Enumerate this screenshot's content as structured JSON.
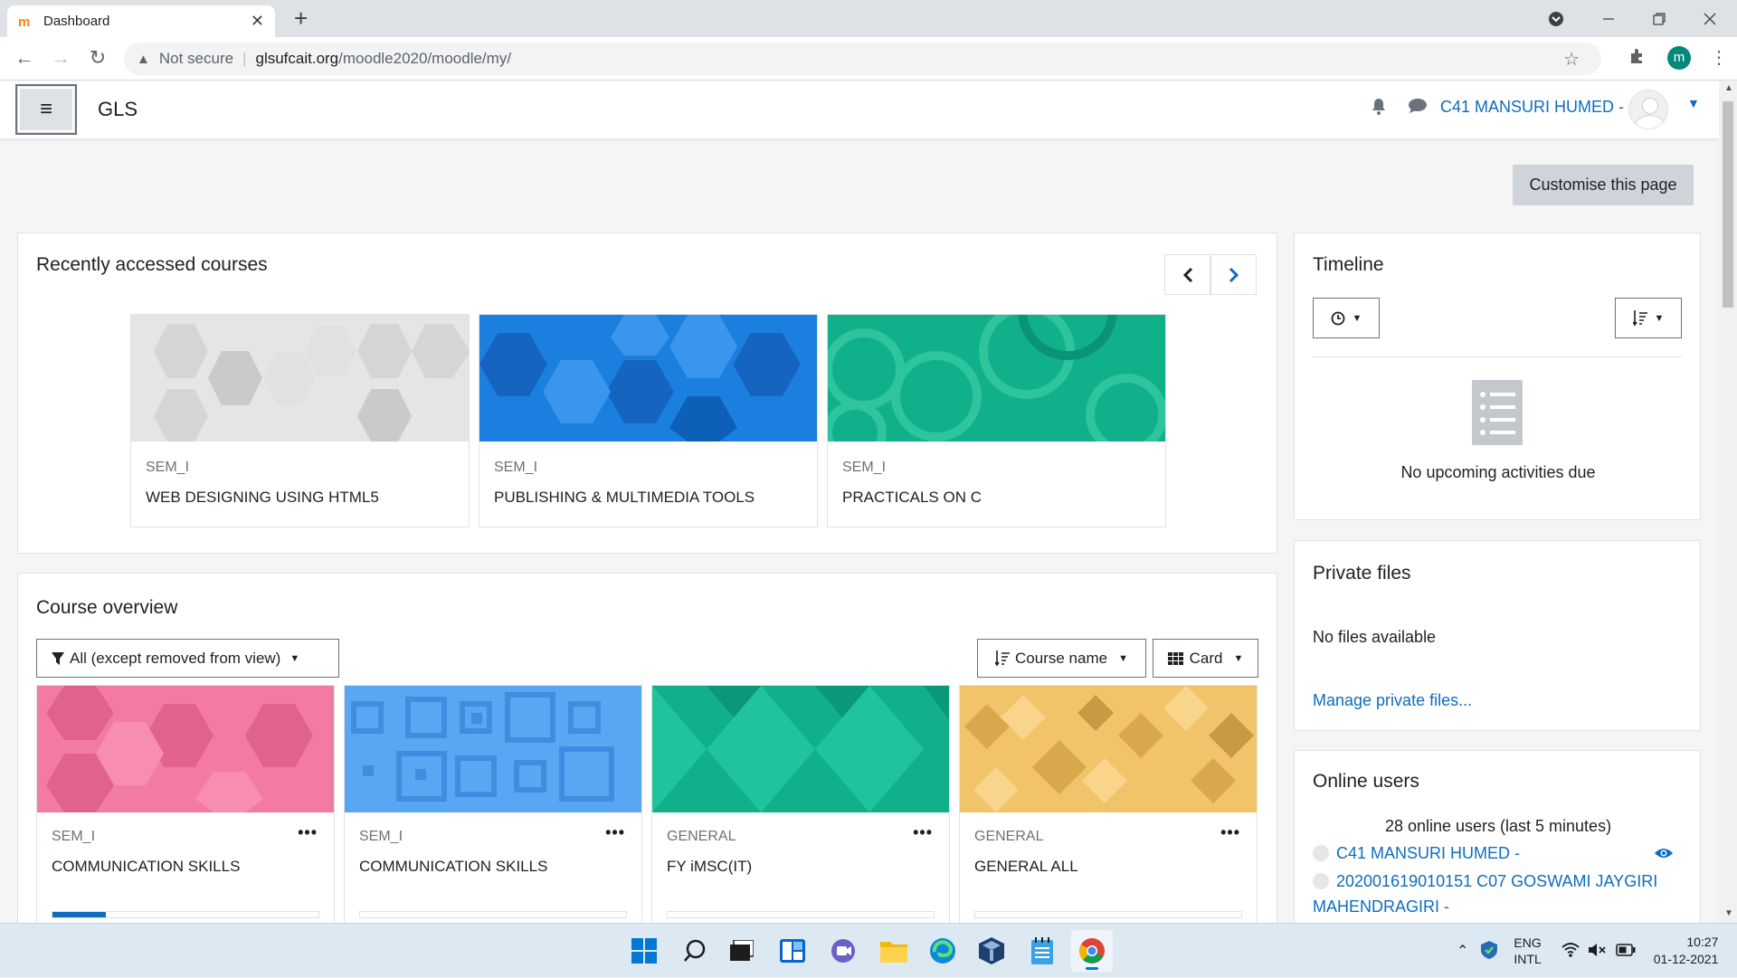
{
  "browser": {
    "tab_title": "Dashboard",
    "tab_close": "✕",
    "new_tab": "+",
    "security_warning": "Not secure",
    "url_host": "glsufcait.org",
    "url_path": "/moodle2020/moodle/my/",
    "profile_initial": "m"
  },
  "navbar": {
    "brand": "GLS",
    "username": "C41 MANSURI HUMED -"
  },
  "page": {
    "customise_label": "Customise this page"
  },
  "recent": {
    "title": "Recently accessed courses",
    "courses": [
      {
        "category": "SEM_I",
        "name": "WEB DESIGNING USING HTML5"
      },
      {
        "category": "SEM_I",
        "name": "PUBLISHING & MULTIMEDIA TOOLS"
      },
      {
        "category": "SEM_I",
        "name": "PRACTICALS ON C"
      }
    ]
  },
  "overview": {
    "title": "Course overview",
    "filter_label": "All (except removed from view)",
    "sort_label": "Course name",
    "view_label": "Card",
    "courses": [
      {
        "category": "SEM_I",
        "name": "COMMUNICATION SKILLS",
        "progress": 0.2
      },
      {
        "category": "SEM_I",
        "name": "COMMUNICATION SKILLS",
        "progress": 0
      },
      {
        "category": "GENERAL",
        "name": "FY iMSC(IT)",
        "progress": 0
      },
      {
        "category": "GENERAL",
        "name": "GENERAL ALL",
        "progress": 0
      }
    ],
    "more_label": "•••"
  },
  "timeline": {
    "title": "Timeline",
    "empty_text": "No upcoming activities due"
  },
  "private_files": {
    "title": "Private files",
    "empty_text": "No files available",
    "manage_link": "Manage private files..."
  },
  "online_users": {
    "title": "Online users",
    "summary": "28 online users (last 5 minutes)",
    "users": [
      "C41 MANSURI HUMED -",
      "202001619010151 C07 GOSWAMI JAYGIRI",
      "MAHENDRAGIRI -"
    ]
  },
  "taskbar": {
    "lang_top": "ENG",
    "lang_bottom": "INTL",
    "time": "10:27",
    "date": "01-12-2021"
  },
  "colors": {
    "link": "#0f6cbf",
    "brand_accent": "#f98012"
  }
}
